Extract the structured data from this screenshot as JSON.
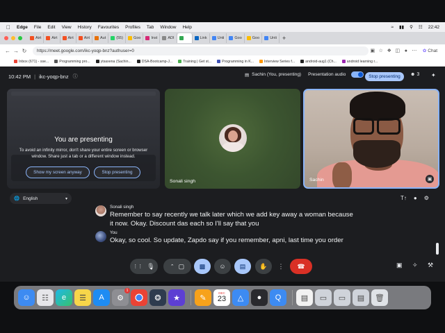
{
  "menubar": {
    "app": "Edge",
    "items": [
      "File",
      "Edit",
      "View",
      "History",
      "Favourites",
      "Profiles",
      "Tab",
      "Window",
      "Help"
    ],
    "clock": "22:42"
  },
  "tabs": [
    {
      "label": "Airt",
      "color": "#f25022"
    },
    {
      "label": "Airt",
      "color": "#f25022"
    },
    {
      "label": "Airt",
      "color": "#f25022"
    },
    {
      "label": "Airt",
      "color": "#f25022"
    },
    {
      "label": "Aut",
      "color": "#e8710a"
    },
    {
      "label": "(55)",
      "color": "#25d366"
    },
    {
      "label": "Goo",
      "color": "#fbbc04"
    },
    {
      "label": "Inst",
      "color": "#d62976"
    },
    {
      "label": "ADI",
      "color": "#888888"
    },
    {
      "label": "",
      "color": "#34a853"
    },
    {
      "label": "Link",
      "color": "#0a66c2"
    },
    {
      "label": "Unti",
      "color": "#4285f4"
    },
    {
      "label": "Goo",
      "color": "#4285f4"
    },
    {
      "label": "Goo",
      "color": "#fbbc04"
    },
    {
      "label": "Unti",
      "color": "#4285f4"
    }
  ],
  "address": {
    "url": "https://meet.google.com/ikc-yoqp-bnz?authuser=0",
    "chat_label": "Chat"
  },
  "bookmarks": [
    "Inbox (671) - sse...",
    "Programming pro...",
    "ytsaxena (Sachin...",
    "DSA-Bootcamp-J...",
    "Training | Get st...",
    "Programming in K...",
    "Interview Series f...",
    "android-aug1 (Ch...",
    "android learning r..."
  ],
  "meet": {
    "time": "10:42 PM",
    "separator": "|",
    "code": "ikc-yoqp-bnz",
    "presenting_label": "Sachin (You, presenting)",
    "audio_label": "Presentation audio",
    "audio_enabled": true,
    "stop_button": "Stop presenting",
    "participant_count": "3",
    "present_tile": {
      "title": "You are presenting",
      "subtitle": "To avoid an infinity mirror, don't share your entire screen or browser window. Share just a tab or a different window instead.",
      "show_anyway": "Show my screen anyway",
      "stop": "Stop presenting"
    },
    "tiles": [
      {
        "name": "Sonali singh"
      },
      {
        "name": "Sachin"
      }
    ],
    "language": "English",
    "captions": [
      {
        "speaker": "Sonali singh",
        "text": "Remember to say recently we talk later which we add key away a woman because it now. Okay. Discount das each so I'll say that you"
      },
      {
        "speaker": "You",
        "text": "Okay, so cool. So update, Zapdo say if you remember, apni, last time you order"
      }
    ],
    "colors": {
      "accent": "#a8c7fa",
      "end_call": "#d93025",
      "tile_border": "#8ab4f8"
    }
  },
  "dock": {
    "calendar_month": "DEC",
    "calendar_day": "23",
    "settings_badge": "1"
  }
}
